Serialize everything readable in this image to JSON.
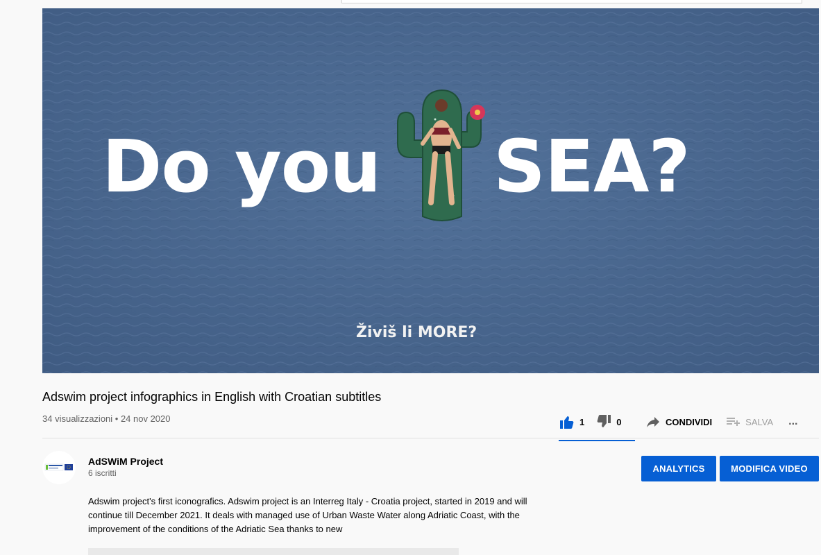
{
  "video": {
    "headline_left": "Do you",
    "headline_right": "SEA?",
    "subtitle": "Živiš li MORE?",
    "title": "Adswim project infographics in English with Croatian subtitles",
    "meta": "34 visualizzazioni • 24 nov 2020"
  },
  "actions": {
    "likes": "1",
    "dislikes": "0",
    "share_label": "CONDIVIDI",
    "save_label": "SALVA",
    "more_label": "..."
  },
  "channel": {
    "name": "AdSWiM Project",
    "subscribers": "6 iscritti",
    "avatar_icon": "interreg-logo"
  },
  "buttons": {
    "analytics": "ANALYTICS",
    "edit": "MODIFICA VIDEO"
  },
  "description": {
    "text": "Adswim project's first iconografics. Adswim project is an Interreg Italy - Croatia project, started in 2019 and will continue till December 2021. It deals with managed use of Urban Waste Water along Adriatic Coast, with the improvement of the conditions of the Adriatic Sea thanks to new"
  },
  "colors": {
    "accent": "#065fd4",
    "sea": "#4b6890",
    "background": "#f9f9f9"
  }
}
